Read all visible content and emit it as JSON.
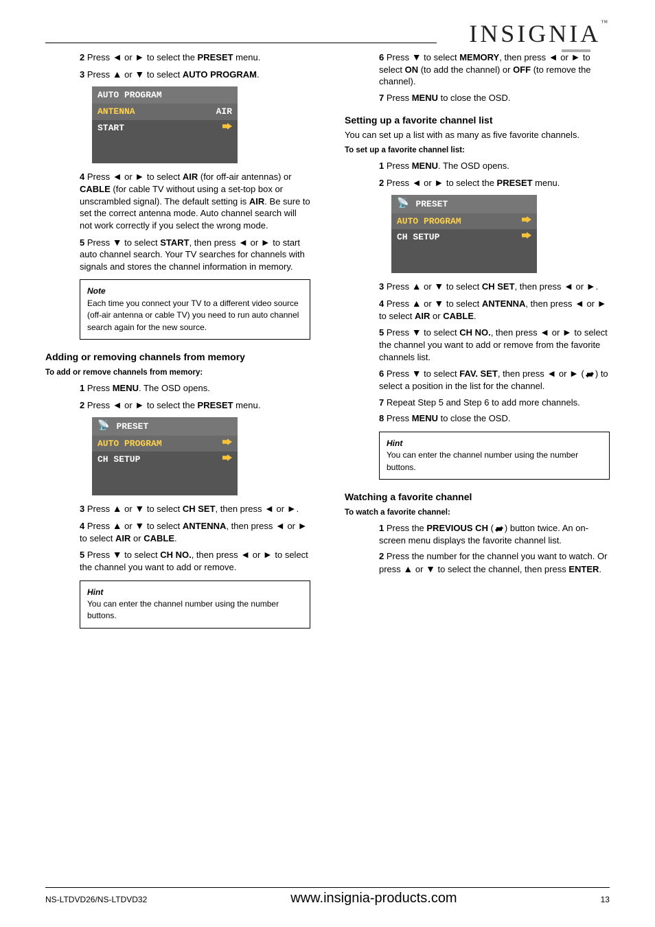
{
  "logo": "INSIGNIA",
  "tm": "™",
  "left": {
    "step2": {
      "n": "2",
      "text_a": "Press ",
      "or1": " or ",
      "text_b": " to select the ",
      "preset": "PRESET",
      "text_c": " menu."
    },
    "step3": {
      "n": "3",
      "a": "Press ",
      "or1": " or ",
      "b": " to select ",
      "autoprog": "AUTO PROGRAM",
      "c": "."
    },
    "osd1": {
      "title": "AUTO PROGRAM",
      "r1_label": "ANTENNA",
      "r1_val": "AIR",
      "r2_label": "START"
    },
    "step4": {
      "n": "4",
      "a": "Press ",
      "or": " or ",
      "b": " to select ",
      "air": "AIR",
      "c": " (for off-air antennas) or ",
      "cable": "CABLE",
      "d": " (for cable TV without using a set-top box or unscrambled signal). The default setting is ",
      "air2": "AIR",
      "e": ". Be sure to set the correct antenna mode. Auto channel search will not work correctly if you select the wrong mode."
    },
    "step5": {
      "n": "5",
      "a": "Press ",
      "b": " to select ",
      "start": "START",
      "c": ", then press ",
      "or": " or ",
      "d": " to start auto channel search. Your TV searches for channels with signals and stores the channel information in memory."
    },
    "note1": {
      "title": "Note",
      "body": "Each time you connect your TV to a different video source (off-air antenna or cable TV) you need to run auto channel search again for the new source."
    },
    "addremove": {
      "heading": "Adding or removing channels from memory",
      "lead": "To add or remove channels from memory:",
      "s1": {
        "n": "1",
        "a": "Press ",
        "menu": "MENU",
        "b": ". The OSD opens."
      },
      "s2": {
        "n": "2",
        "a": "Press ",
        "or": " or ",
        "b": " to select the ",
        "preset": "PRESET",
        "c": " menu."
      }
    },
    "osd2": {
      "title": "PRESET",
      "r1": "AUTO PROGRAM",
      "r2": "CH SETUP"
    },
    "sublist": {
      "a": {
        "n": "3",
        "a": "Press ",
        "or": " or ",
        "b": " to select ",
        "ch": "CH SET",
        "c": ", then press ",
        "or2": " or ",
        "d": "."
      },
      "b": {
        "n": "4",
        "a": "Press ",
        "or": " or ",
        "b": " to select ",
        "ant": "ANTENNA",
        "c": ", then press ",
        "or2": " or ",
        "d": " to select ",
        "air": "AIR",
        "e": " or ",
        "cable": "CABLE",
        "f": "."
      },
      "c": {
        "n": "5",
        "a": "Press ",
        "b": " to select ",
        "ch": "CH NO.",
        "c": ", then press ",
        "or": " or ",
        "d": " to select the channel you want to add or remove."
      }
    },
    "hint": {
      "title": "Hint",
      "body": "You can enter the channel number using the number buttons."
    }
  },
  "right": {
    "step6": {
      "n": "6",
      "a": "Press ",
      "b": " to select ",
      "mem": "MEMORY",
      "c": ", then press ",
      "or": " or ",
      "d": " to select ",
      "on": "ON",
      "e": " (to add the channel) or ",
      "off": "OFF",
      "f": " (to remove the channel)."
    },
    "step7": {
      "n": "7",
      "a": "Press ",
      "menu": "MENU",
      "b": " to close the OSD."
    },
    "fav": {
      "heading": "Setting up a favorite channel list",
      "intro": "You can set up a list with as many as five favorite channels.",
      "lead": "To set up a favorite channel list:",
      "s1": {
        "n": "1",
        "a": "Press ",
        "menu": "MENU",
        "b": ". The OSD opens."
      },
      "s2": {
        "n": "2",
        "a": "Press ",
        "or": " or ",
        "b": " to select the ",
        "preset": "PRESET",
        "c": " menu."
      }
    },
    "osd3": {
      "title": "PRESET",
      "r1": "AUTO PROGRAM",
      "r2": "CH SETUP"
    },
    "sub": {
      "a": {
        "n": "3",
        "a": "Press ",
        "or": " or ",
        "b": " to select ",
        "ch": "CH SET",
        "c": ", then press ",
        "or2": " or ",
        "d": "."
      },
      "b": {
        "n": "4",
        "a": "Press ",
        "or": " or ",
        "b": " to select ",
        "ant": "ANTENNA",
        "c": ", then press ",
        "or2": " or ",
        "d": " to select ",
        "air": "AIR",
        "e": " or ",
        "cable": "CABLE",
        "f": "."
      },
      "c": {
        "n": "5",
        "a": "Press ",
        "b": " to select ",
        "ch": "CH NO.",
        "c": ", then press ",
        "or": " or ",
        "d": " to select the channel you want to add or remove from the favorite channels list."
      },
      "d": {
        "n": "6",
        "a": "Press ",
        "b": " to select ",
        "fs": "FAV. SET",
        "c": ", then press ",
        "or": " or ",
        "d": "(",
        "e": ") to select a position in the list for the channel."
      },
      "e": {
        "n": "7",
        "a": "Repeat Step 5 and Step 6 to add more channels."
      },
      "f": {
        "n": "8",
        "a": "Press ",
        "menu": "MENU",
        "b": " to close the OSD."
      }
    },
    "hint2": {
      "title": "Hint",
      "body": "You can enter the channel number using the number buttons."
    },
    "watch": {
      "heading": "Watching a favorite channel",
      "lead": "To watch a favorite channel:",
      "s1": {
        "n": "1",
        "a": "Press the ",
        "prev": "PREVIOUS CH",
        "b": " (",
        "c": ") button twice. An on-screen menu displays the favorite channel list."
      },
      "s2": {
        "n": "2",
        "a": "Press the number for the channel you want to watch. Or press ",
        "or": " or ",
        "b": " to select the channel, then press ",
        "enter": "ENTER",
        "c": "."
      }
    }
  },
  "footer": {
    "model": "NS-LTDVD26/NS-LTDVD32",
    "site": "www.insignia-products.com",
    "page": "13"
  }
}
